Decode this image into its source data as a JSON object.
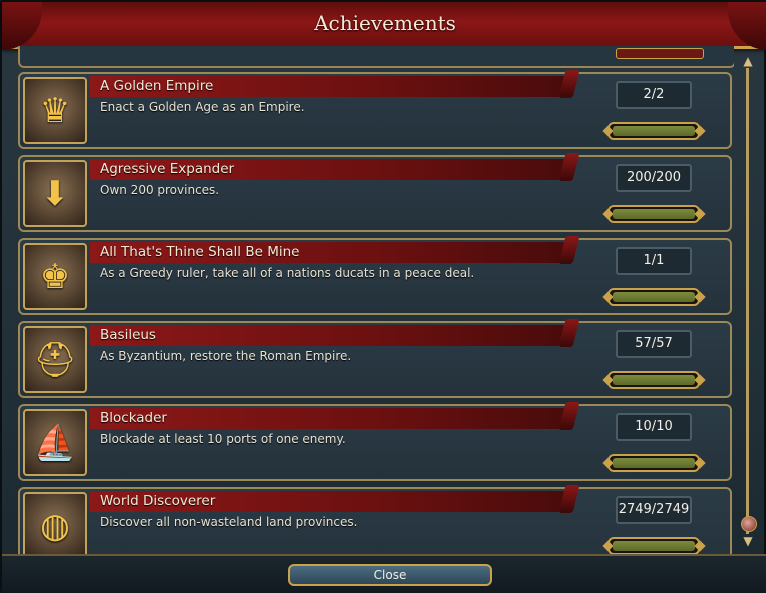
{
  "window": {
    "title": "Achievements"
  },
  "achievements": [
    {
      "name": "A Golden Empire",
      "description": "Enact a Golden Age as an Empire.",
      "progress_text": "2/2",
      "progress_fraction": 1.0,
      "icon": "crown-icon",
      "glyph": "♛"
    },
    {
      "name": "Agressive Expander",
      "description": "Own 200 provinces.",
      "progress_text": "200/200",
      "progress_fraction": 1.0,
      "icon": "expanding-arrows-icon",
      "glyph": "⬇"
    },
    {
      "name": "All That's Thine Shall Be Mine",
      "description": "As a Greedy ruler, take all of a nations ducats in a peace deal.",
      "progress_text": "1/1",
      "progress_fraction": 1.0,
      "icon": "gold-bars-crown-icon",
      "glyph": "♚"
    },
    {
      "name": "Basileus",
      "description": "As Byzantium, restore the Roman Empire.",
      "progress_text": "57/57",
      "progress_fraction": 1.0,
      "icon": "roman-helmet-icon",
      "glyph": "⛑"
    },
    {
      "name": "Blockader",
      "description": "Blockade at least 10 ports of one enemy.",
      "progress_text": "10/10",
      "progress_fraction": 1.0,
      "icon": "ship-icon",
      "glyph": "⛵"
    },
    {
      "name": "World Discoverer",
      "description": "Discover all non-wasteland land provinces.",
      "progress_text": "2749/2749",
      "progress_fraction": 1.0,
      "icon": "globe-icon",
      "glyph": "◍"
    }
  ],
  "scrollbar": {
    "up_glyph": "▲",
    "down_glyph": "▼",
    "position_fraction": 1.0
  },
  "footer": {
    "close_label": "Close"
  },
  "colors": {
    "ribbon_red": "#8c1818",
    "gold_border": "#c9a24a",
    "progress_green": "#7e8b3c",
    "panel_bg": "#24323b"
  }
}
